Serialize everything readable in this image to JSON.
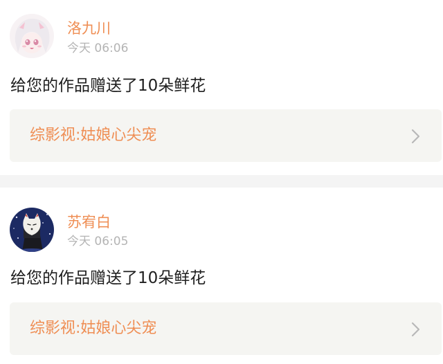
{
  "notifications": [
    {
      "username": "洛九川",
      "time": "今天 06:06",
      "message": "给您的作品赠送了10朵鲜花",
      "work_title": "综影视:姑娘心尖宠"
    },
    {
      "username": "苏宥白",
      "time": "今天 06:05",
      "message": "给您的作品赠送了10朵鲜花",
      "work_title": "综影视:姑娘心尖宠"
    }
  ],
  "colors": {
    "accent": "#ef8e54",
    "muted_text": "#b4b4b4",
    "body_text": "#1e1e1e",
    "link_card_bg": "#f5f5f2",
    "separator": "#f4f4f4"
  },
  "icons": {
    "chevron": "chevron-right-icon"
  }
}
